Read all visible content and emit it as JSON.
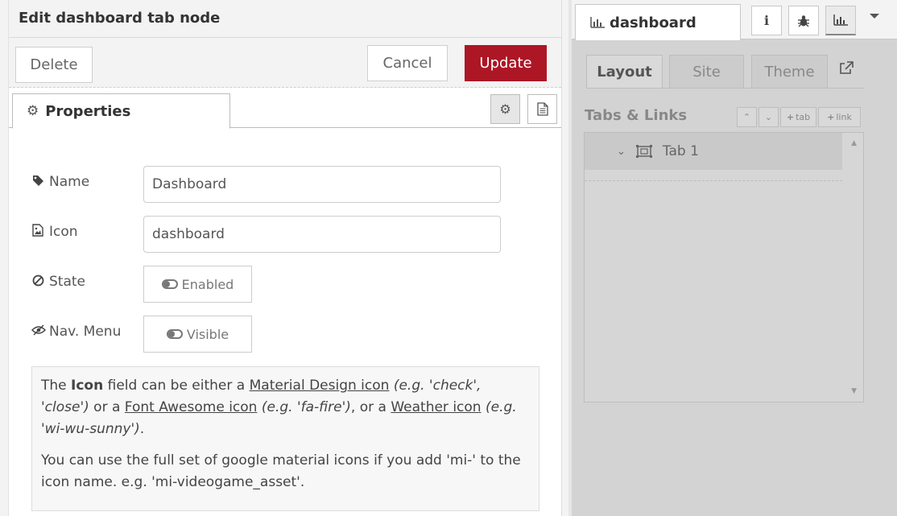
{
  "tray": {
    "title": "Edit dashboard tab node",
    "delete_label": "Delete",
    "cancel_label": "Cancel",
    "update_label": "Update",
    "update_color": "#ad1625"
  },
  "properties_tab": {
    "label": "Properties",
    "icon": "gear-icon"
  },
  "form": {
    "name_label": "Name",
    "name_value": "Dashboard",
    "icon_label": "Icon",
    "icon_value": "dashboard",
    "state_label": "State",
    "state_value": "Enabled",
    "nav_label": "Nav. Menu",
    "nav_value": "Visible"
  },
  "help": {
    "p1_a": "The ",
    "p1_icon": "Icon",
    "p1_b": " field can be either a ",
    "p1_md_link": "Material Design icon",
    "p1_md_eg": "(e.g. 'check', 'close')",
    "p1_c": " or a ",
    "p1_fa_link": "Font Awesome icon",
    "p1_fa_eg": "(e.g. 'fa-fire')",
    "p1_d": ", or a ",
    "p1_wi_link": "Weather icon",
    "p1_wi_eg": "(e.g. 'wi-wu-sunny')",
    "p1_end": ".",
    "p2": "You can use the full set of google material icons if you add 'mi-' to the icon name. e.g. 'mi-videogame_asset'."
  },
  "sidebar": {
    "tab_label": "dashboard",
    "info_icon": "info-icon",
    "debug_icon": "bug-icon",
    "dashboard_icon": "bar-chart-icon",
    "dash_tabs": [
      "Layout",
      "Site",
      "Theme"
    ],
    "section_title": "Tabs & Links",
    "mini_tab_label": "tab",
    "mini_link_label": "link",
    "tree_item": "Tab 1"
  }
}
